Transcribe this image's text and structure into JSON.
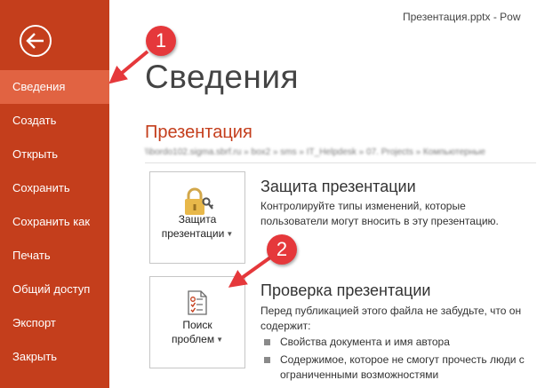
{
  "window": {
    "title": "Презентация.pptx - Pow"
  },
  "sidebar": {
    "back_icon": "back-arrow-icon",
    "items": [
      {
        "label": "Сведения",
        "active": true
      },
      {
        "label": "Создать"
      },
      {
        "label": "Открыть"
      },
      {
        "label": "Сохранить"
      },
      {
        "label": "Сохранить как"
      },
      {
        "label": "Печать"
      },
      {
        "label": "Общий доступ"
      },
      {
        "label": "Экспорт"
      },
      {
        "label": "Закрыть"
      }
    ]
  },
  "main": {
    "title": "Сведения",
    "section": "Презентация",
    "path": "\\\\bordo102.sigma.sbrf.ru » box2 » sms » IT_Helpdesk » 07. Projects » Компьютерные",
    "protect": {
      "tile_line1": "Защита",
      "tile_line2": "презентации",
      "icon": "lock-key-icon",
      "title": "Защита презентации",
      "description": "Контролируйте типы изменений, которые пользователи могут вносить в эту презентацию."
    },
    "inspect": {
      "tile_line1": "Поиск",
      "tile_line2": "проблем",
      "icon": "checklist-icon",
      "title": "Проверка презентации",
      "description": "Перед публикацией этого файла не забудьте, что он содержит:",
      "bullets": [
        "Свойства документа и имя автора",
        "Содержимое, которое не смогут прочесть люди с ограниченными возможностями"
      ]
    }
  },
  "annotations": [
    {
      "number": "1",
      "color": "#e5383b"
    },
    {
      "number": "2",
      "color": "#e5383b"
    }
  ],
  "colors": {
    "sidebar": "#c43e1c",
    "sidebar_active": "#e16342",
    "accent": "#c43e1c"
  }
}
